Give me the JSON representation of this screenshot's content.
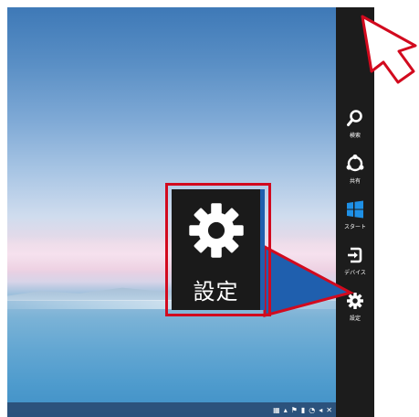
{
  "charms": [
    {
      "label": "検索",
      "icon": "search-icon"
    },
    {
      "label": "共有",
      "icon": "share-icon"
    },
    {
      "label": "スタート",
      "icon": "windows-start-icon"
    },
    {
      "label": "デバイス",
      "icon": "devices-icon"
    },
    {
      "label": "設定",
      "icon": "gear-icon"
    }
  ],
  "callout": {
    "label": "設定",
    "icon": "gear-icon"
  },
  "colors": {
    "charm_bar": "#1c1c1c",
    "highlight_border": "#d20a1e",
    "accent_blue": "#1f5fae",
    "start_tile": "#1e90e6"
  },
  "cursor": {
    "icon": "mouse-cursor-icon"
  }
}
